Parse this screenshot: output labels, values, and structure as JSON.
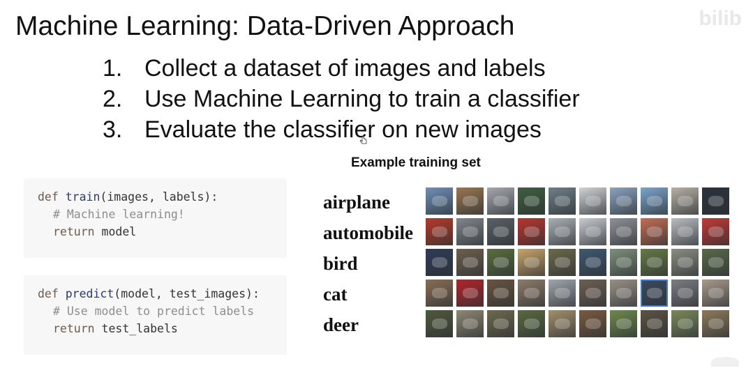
{
  "slide": {
    "title": "Machine Learning: Data-Driven Approach",
    "steps": [
      {
        "num": "1.",
        "text": "Collect a dataset of images and labels"
      },
      {
        "num": "2.",
        "text": "Use Machine Learning to train a classifier"
      },
      {
        "num": "3.",
        "text": "Evaluate the classifier on new images"
      }
    ],
    "watermark": "bilib"
  },
  "code": {
    "train": {
      "kw_def": "def",
      "fn_name": "train",
      "params": "(images, labels):",
      "comment": "# Machine learning!",
      "kw_return": "return",
      "ret_value": " model"
    },
    "predict": {
      "kw_def": "def",
      "fn_name": "predict",
      "params": "(model, test_images):",
      "comment": "# Use model to predict labels",
      "kw_return": "return",
      "ret_value": " test_labels"
    }
  },
  "training_set": {
    "caption": "Example training set",
    "classes": [
      {
        "label": "airplane",
        "colors": [
          "#6f8fb6",
          "#9a7650",
          "#a5a9ad",
          "#3e5f3f",
          "#6e7f86",
          "#cfd3d6",
          "#8aa3bf",
          "#7aa4cc",
          "#b8b0a4",
          "#2d333b"
        ]
      },
      {
        "label": "automobile",
        "colors": [
          "#b43a2a",
          "#7f858b",
          "#5a6066",
          "#b8352e",
          "#a9afb5",
          "#c7cbd0",
          "#8e9296",
          "#c46e55",
          "#b9bcc0",
          "#c13a35"
        ]
      },
      {
        "label": "bird",
        "colors": [
          "#2e3c58",
          "#6d5f4e",
          "#5a6e3e",
          "#c9a46a",
          "#6b6a4a",
          "#3f5871",
          "#7d8f7a",
          "#667a45",
          "#8a8f80",
          "#5a6a4a"
        ]
      },
      {
        "label": "cat",
        "colors": [
          "#8a6e52",
          "#b3242a",
          "#6a543e",
          "#8d7b68",
          "#a0a5ac",
          "#6f5f52",
          "#9a9186",
          "#3c4a5c",
          "#7a7e82",
          "#a89a8a"
        ]
      },
      {
        "label": "deer",
        "colors": [
          "#4f5a3a",
          "#8d8672",
          "#6e6a4c",
          "#5a6a3e",
          "#a38f6a",
          "#7a5a3e",
          "#6e8a4c",
          "#5c5242",
          "#7a8a5a",
          "#8d7a5a"
        ]
      }
    ],
    "selected": {
      "row": 3,
      "col": 7
    }
  }
}
